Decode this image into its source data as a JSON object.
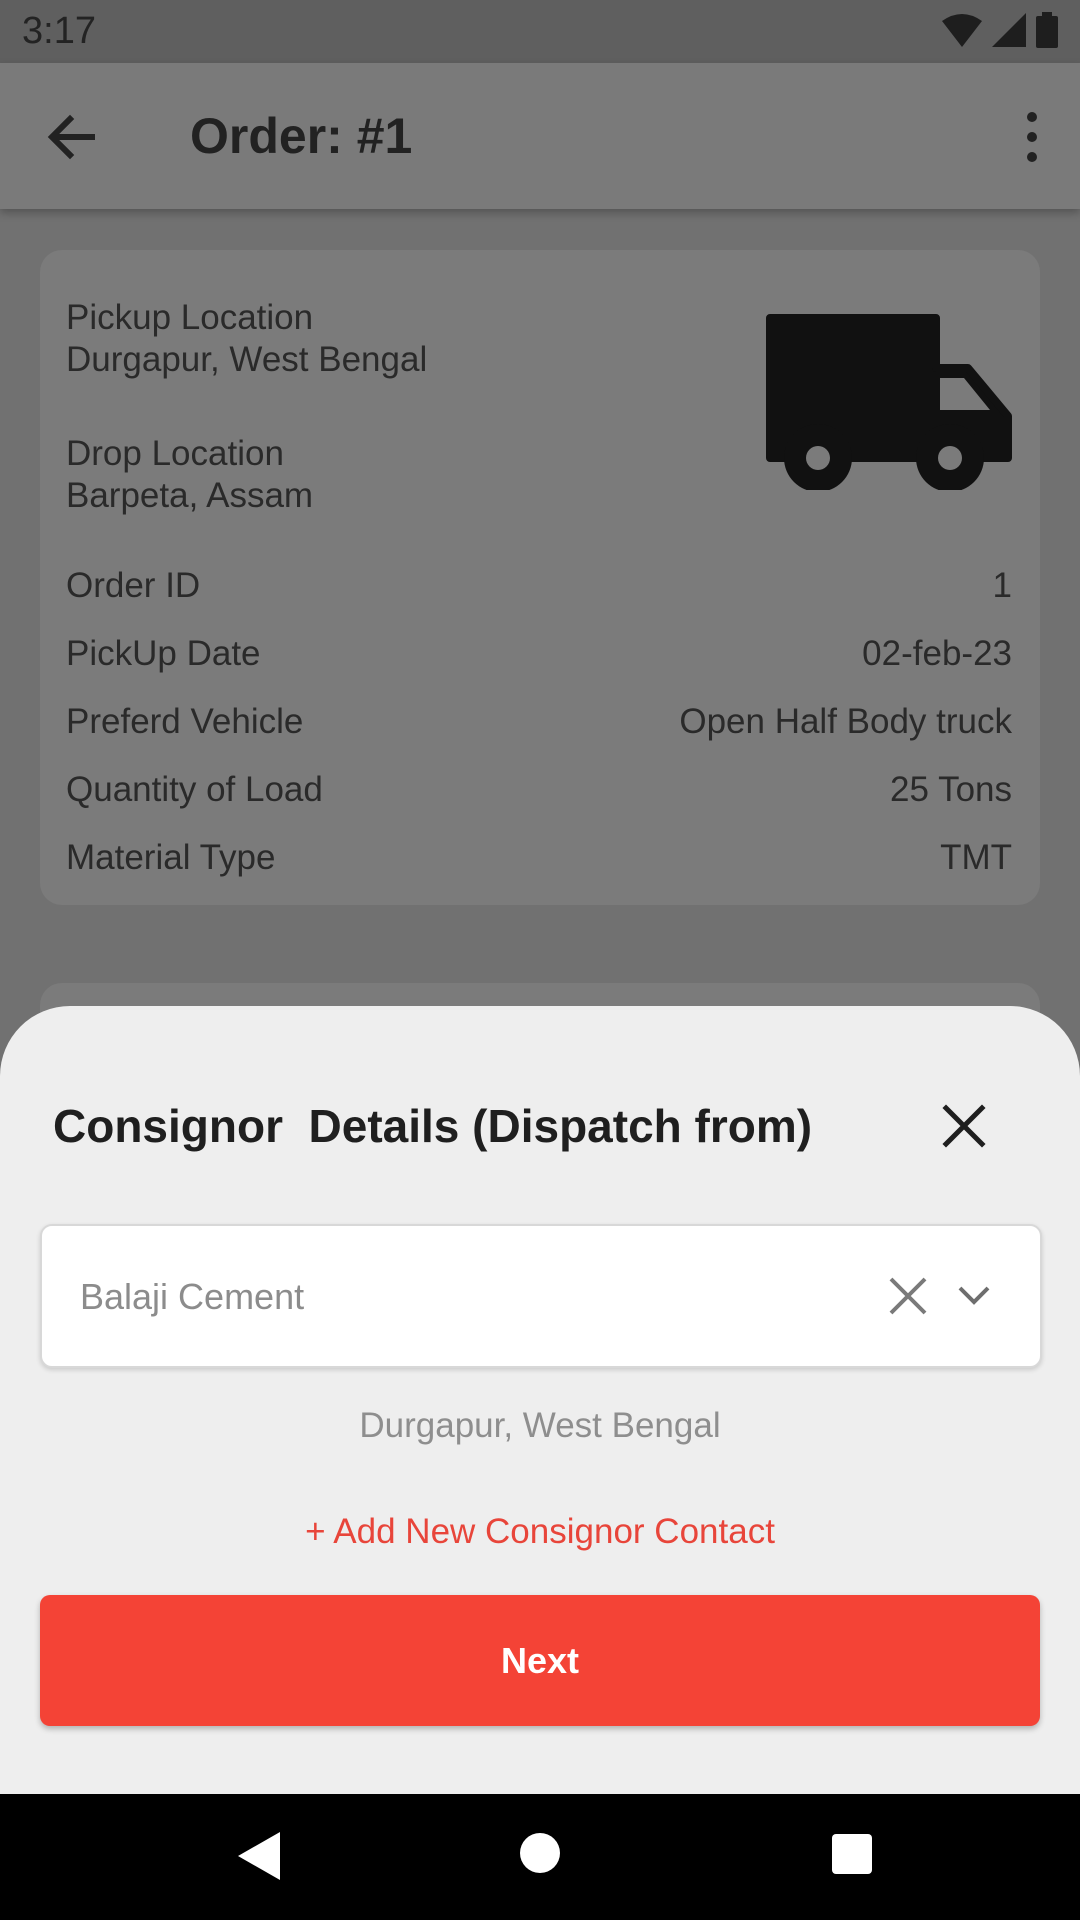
{
  "status_bar": {
    "time": "3:17"
  },
  "app_bar": {
    "title": "Order: #1"
  },
  "order_card": {
    "pickup_label": "Pickup Location",
    "pickup_value": "Durgapur, West Bengal",
    "drop_label": "Drop Location",
    "drop_value": "Barpeta, Assam",
    "rows": [
      {
        "label": "Order ID",
        "value": "1"
      },
      {
        "label": "PickUp Date",
        "value": "02-feb-23"
      },
      {
        "label": "Preferd Vehicle",
        "value": "Open Half Body truck"
      },
      {
        "label": "Quantity of Load",
        "value": "25 Tons"
      },
      {
        "label": "Material Type",
        "value": "TMT"
      }
    ]
  },
  "sheet": {
    "title": "Consignor  Details (Dispatch from)",
    "selected_consignor": "Balaji Cement",
    "address": "Durgapur, West Bengal",
    "add_link": "+ Add New Consignor Contact",
    "next_label": "Next"
  },
  "colors": {
    "accent": "#f44336",
    "link": "#e8453a",
    "sheet_bg": "#eeeeee"
  },
  "icons": [
    "back-arrow-icon",
    "more-vert-icon",
    "truck-icon",
    "close-icon",
    "chevron-down-icon",
    "wifi-icon",
    "signal-icon",
    "battery-icon"
  ]
}
